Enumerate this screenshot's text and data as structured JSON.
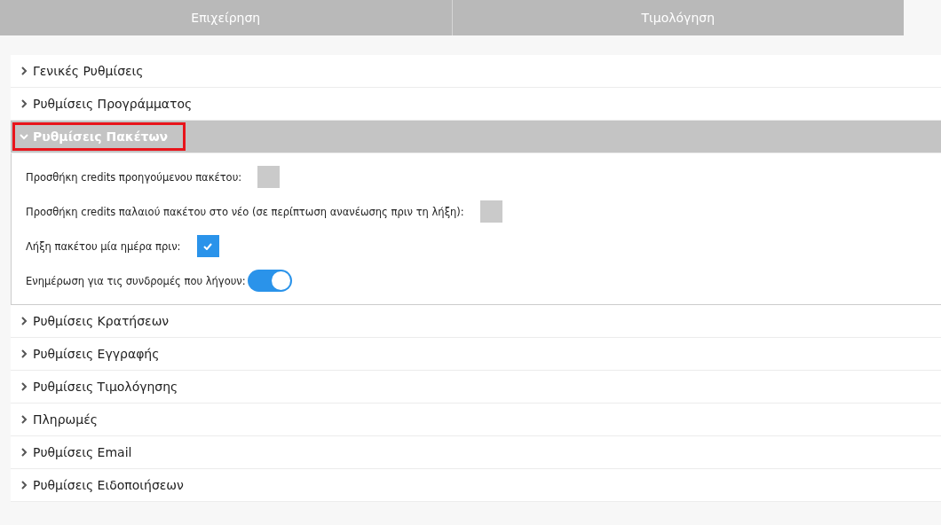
{
  "tabs": [
    {
      "label": "Επιχείρηση"
    },
    {
      "label": "Τιμολόγηση"
    }
  ],
  "sections": [
    {
      "title": "Γενικές Ρυθμίσεις",
      "expanded": false
    },
    {
      "title": "Ρυθμίσεις Προγράμματος",
      "expanded": false
    },
    {
      "title": "Ρυθμίσεις Πακέτων",
      "expanded": true,
      "highlighted": true,
      "settings": [
        {
          "kind": "checkbox",
          "label": "Προσθήκη credits προηγούμενου πακέτου:",
          "checked": false
        },
        {
          "kind": "checkbox",
          "label": "Προσθήκη credits παλαιού πακέτου στο νέο (σε περίπτωση ανανέωσης πριν τη λήξη):",
          "checked": false
        },
        {
          "kind": "checkbox",
          "label": "Λήξη πακέτου μία ημέρα πριν:",
          "checked": true
        },
        {
          "kind": "toggle",
          "label": "Ενημέρωση για τις συνδρομές που λήγουν:",
          "on": true
        }
      ]
    },
    {
      "title": "Ρυθμίσεις Κρατήσεων",
      "expanded": false
    },
    {
      "title": "Ρυθμίσεις Εγγραφής",
      "expanded": false
    },
    {
      "title": "Ρυθμίσεις Τιμολόγησης",
      "expanded": false
    },
    {
      "title": "Πληρωμές",
      "expanded": false
    },
    {
      "title": "Ρυθμίσεις Email",
      "expanded": false
    },
    {
      "title": "Ρυθμίσεις Ειδοποιήσεων",
      "expanded": false
    }
  ]
}
